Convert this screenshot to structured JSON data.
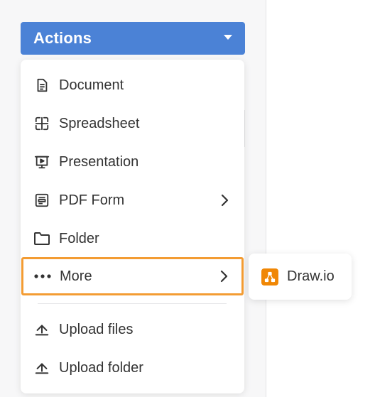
{
  "actions_button": {
    "label": "Actions",
    "icon": "caret-down-icon"
  },
  "menu": {
    "items": [
      {
        "label": "Document",
        "icon": "document-icon",
        "has_submenu": false
      },
      {
        "label": "Spreadsheet",
        "icon": "spreadsheet-icon",
        "has_submenu": false
      },
      {
        "label": "Presentation",
        "icon": "presentation-icon",
        "has_submenu": false
      },
      {
        "label": "PDF Form",
        "icon": "pdf-form-icon",
        "has_submenu": true
      },
      {
        "label": "Folder",
        "icon": "folder-icon",
        "has_submenu": false
      },
      {
        "label": "More",
        "icon": "more-dots-icon",
        "has_submenu": true,
        "highlighted": true
      }
    ],
    "uploads": [
      {
        "label": "Upload files",
        "icon": "upload-icon"
      },
      {
        "label": "Upload folder",
        "icon": "upload-icon"
      }
    ]
  },
  "submenu": {
    "items": [
      {
        "label": "Draw.io",
        "icon": "drawio-icon"
      }
    ]
  },
  "colors": {
    "accent": "#4b82d6",
    "highlight_border": "#f39c33",
    "drawio_orange": "#f08705",
    "text": "#333333"
  }
}
